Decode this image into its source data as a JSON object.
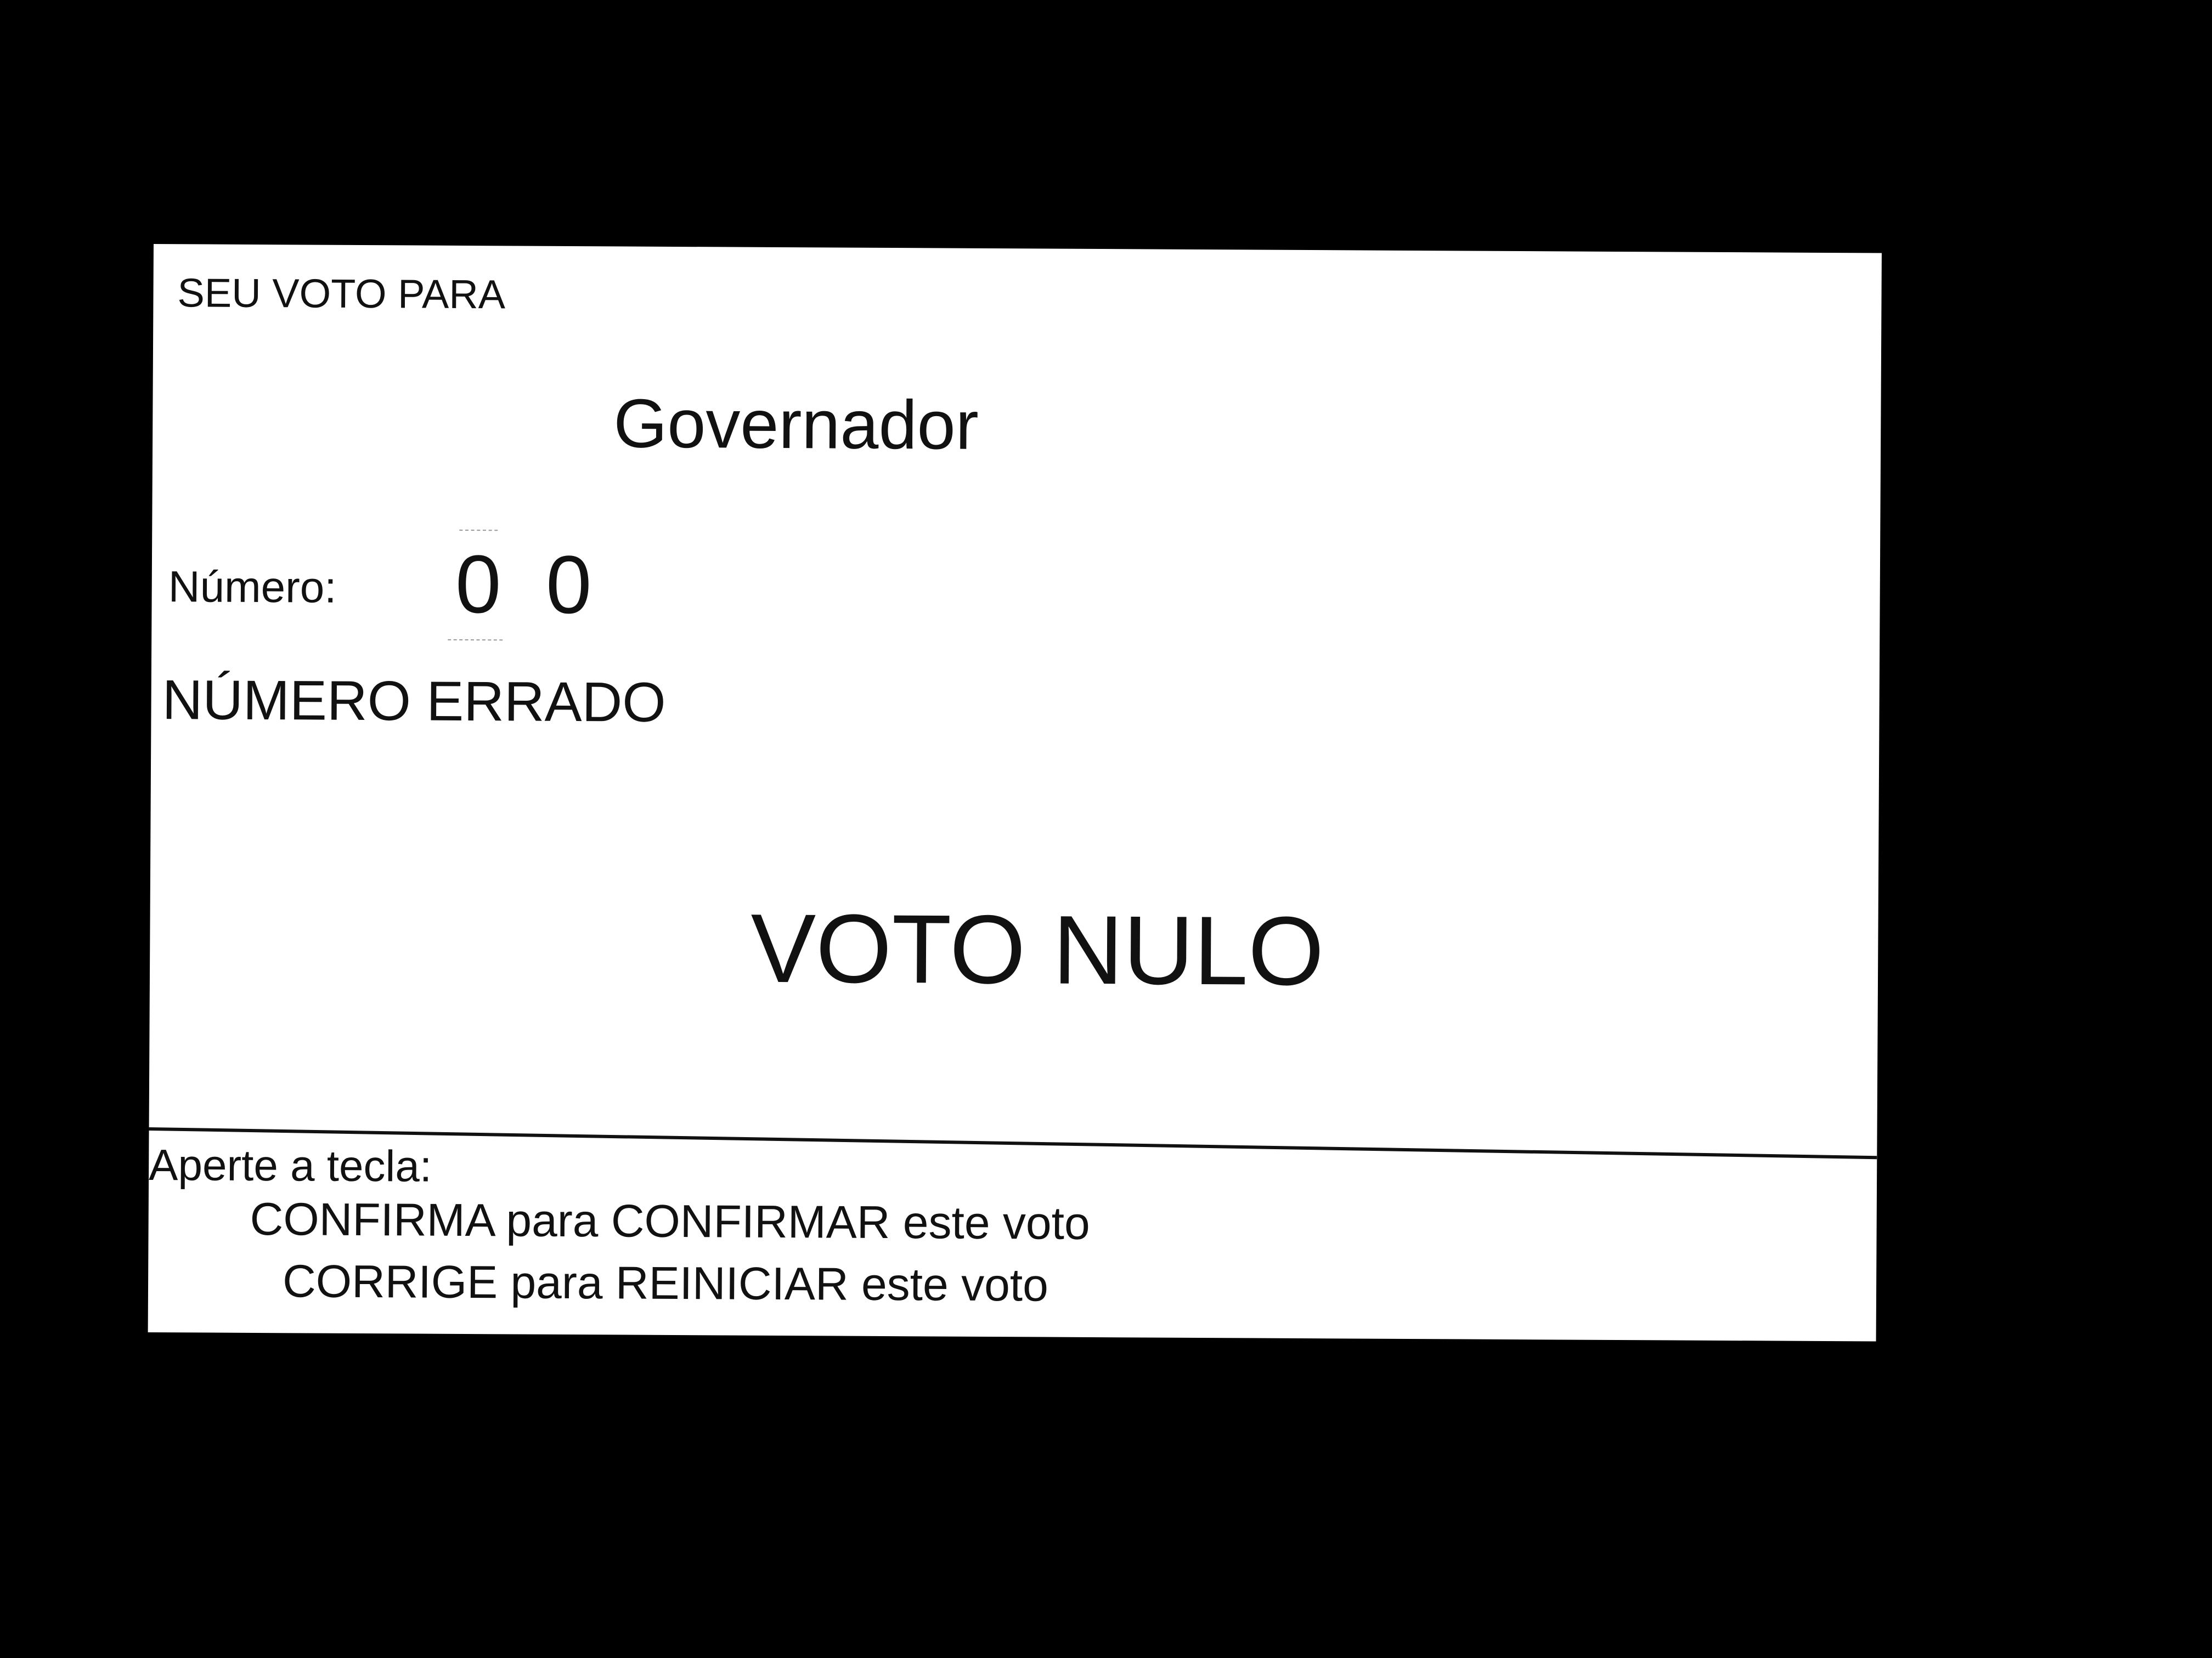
{
  "ballot": {
    "header": "SEU VOTO PARA",
    "office": "Governador",
    "number_label": "Número:",
    "digits": [
      "0",
      "0"
    ],
    "warning": "NÚMERO ERRADO",
    "result": "VOTO NULO"
  },
  "instructions": {
    "press_key": "Aperte a tecla:",
    "confirm": {
      "key": "CONFIRMA",
      "connector": "para",
      "action": "CONFIRMAR",
      "suffix": "este voto"
    },
    "correct": {
      "key": "CORRIGE",
      "connector": "para",
      "action": "REINICIAR",
      "suffix": "este voto"
    }
  },
  "colors": {
    "background": "#000000",
    "screen": "#ffffff",
    "text": "#111111"
  }
}
